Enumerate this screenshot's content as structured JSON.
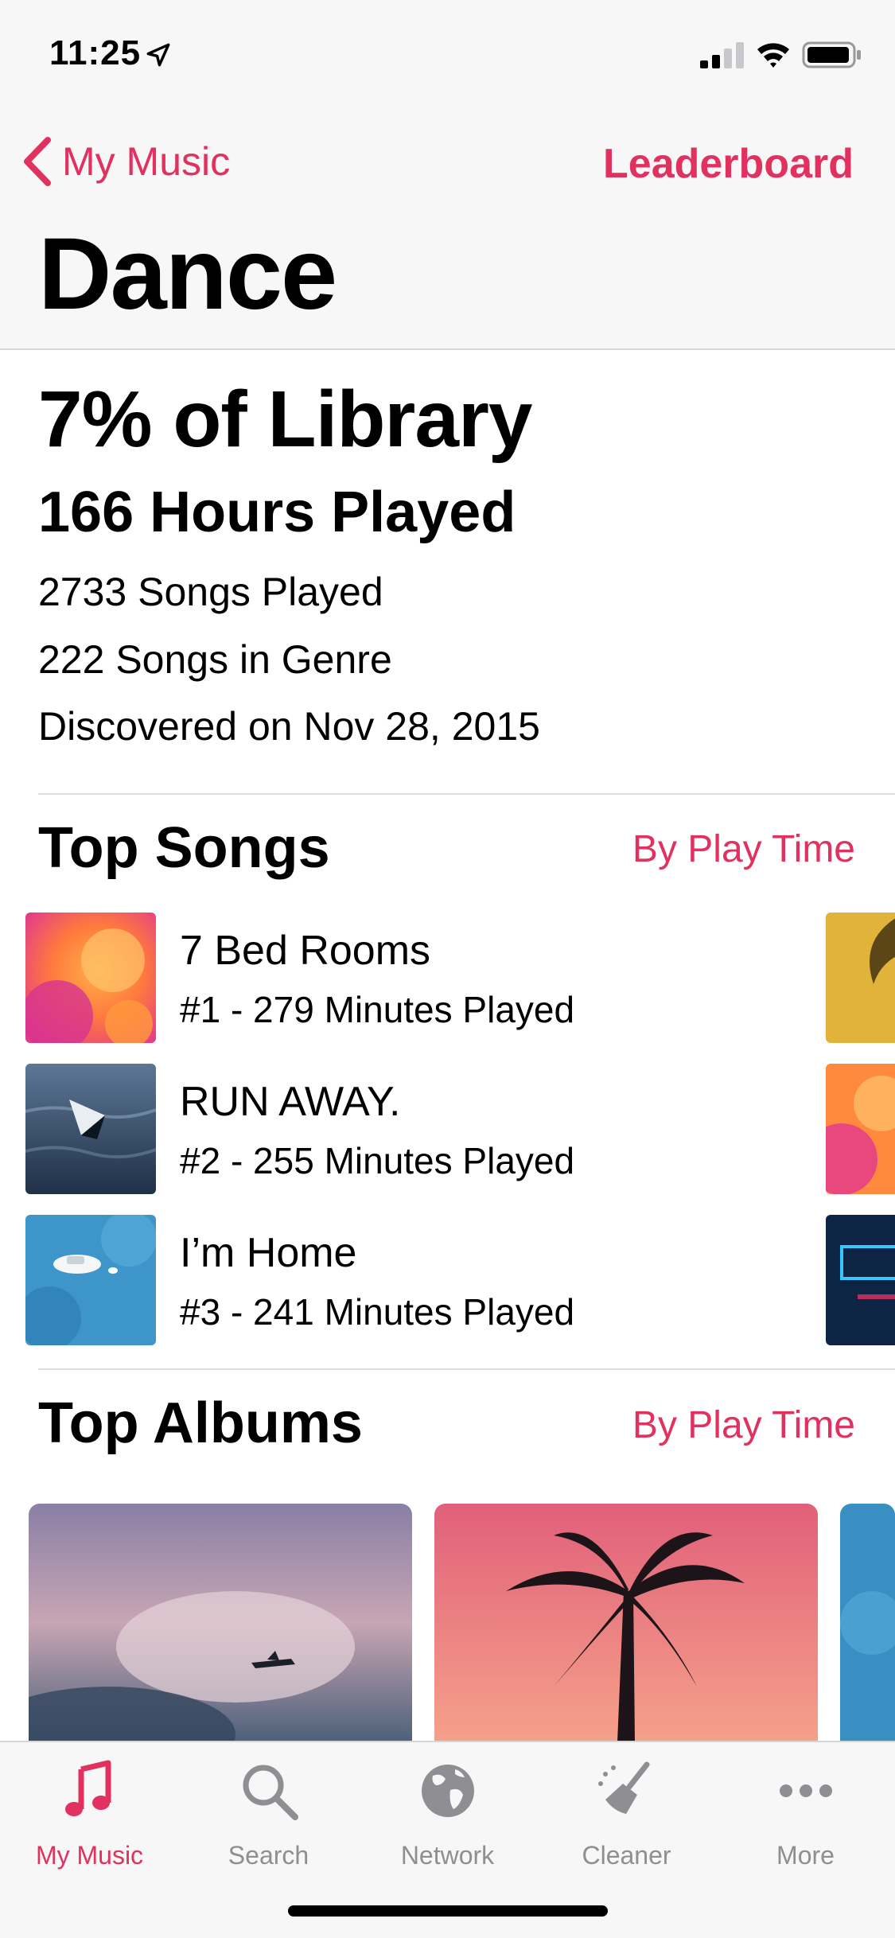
{
  "status": {
    "time": "11:25"
  },
  "nav": {
    "back_label": "My Music",
    "action_label": "Leaderboard",
    "title": "Dance"
  },
  "stats": {
    "library_share": "7% of Library",
    "hours_played": "166 Hours Played",
    "songs_played": "2733 Songs Played",
    "songs_in_genre": "222 Songs in Genre",
    "discovered": "Discovered on Nov 28, 2015"
  },
  "top_songs": {
    "title": "Top Songs",
    "sort_label": "By Play Time",
    "items": [
      {
        "title": "7 Bed Rooms",
        "subtitle": "#1 - 279 Minutes Played"
      },
      {
        "title": "RUN AWAY.",
        "subtitle": "#2 - 255 Minutes Played"
      },
      {
        "title": "I’m Home",
        "subtitle": "#3 - 241 Minutes Played"
      }
    ]
  },
  "top_albums": {
    "title": "Top Albums",
    "sort_label": "By Play Time"
  },
  "tabs": [
    {
      "label": "My Music",
      "icon": "music-note-icon",
      "active": true
    },
    {
      "label": "Search",
      "icon": "search-icon",
      "active": false
    },
    {
      "label": "Network",
      "icon": "globe-icon",
      "active": false
    },
    {
      "label": "Cleaner",
      "icon": "broom-icon",
      "active": false
    },
    {
      "label": "More",
      "icon": "more-icon",
      "active": false
    }
  ],
  "colors": {
    "accent": "#e0315f",
    "inactive_tab": "#8e8e93",
    "bar_background": "#f7f7f7"
  }
}
